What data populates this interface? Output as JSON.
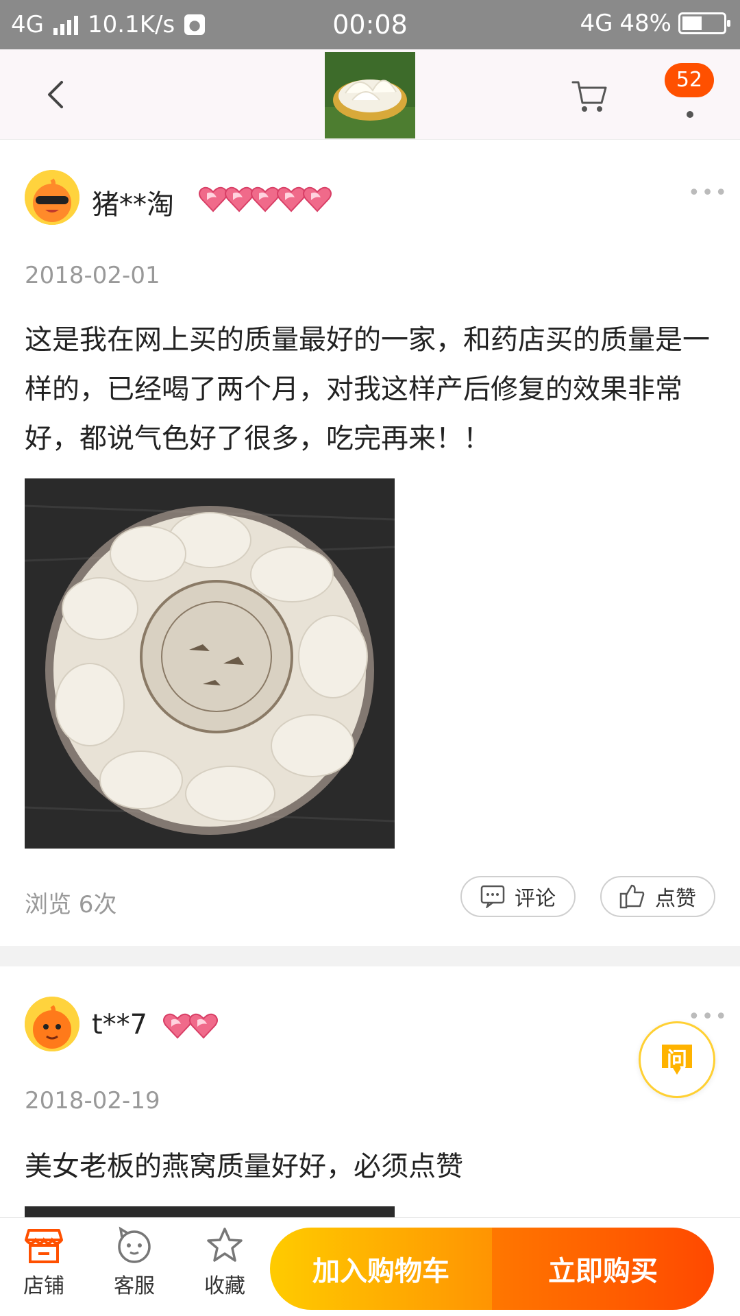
{
  "status_bar": {
    "network": "4G",
    "speed": "10.1K/s",
    "time": "00:08",
    "network_right": "4G",
    "battery": "48%",
    "battery_level": 0.48
  },
  "header": {
    "cart_badge": "52"
  },
  "reviews": [
    {
      "username": "猪**淘",
      "hearts": 5,
      "date": "2018-02-01",
      "text": "这是我在网上买的质量最好的一家，和药店买的质量是一样的，已经喝了两个月，对我这样产后修复的效果非常好，都说气色好了很多，吃完再来！！",
      "views": "浏览 6次",
      "comment_label": "评论",
      "like_label": "点赞"
    },
    {
      "username": "t**7",
      "hearts": 2,
      "date": "2018-02-19",
      "text": "美女老板的燕窝质量好好，必须点赞"
    }
  ],
  "ask_button": {
    "label": "问"
  },
  "bottom_bar": {
    "shop_label": "店铺",
    "service_label": "客服",
    "favorite_label": "收藏",
    "add_cart_label": "加入购物车",
    "buy_now_label": "立即购买"
  },
  "colors": {
    "accent_orange": "#ff5000",
    "cart_gradient_start": "#ffcb00",
    "buy_gradient_end": "#ff4900"
  }
}
